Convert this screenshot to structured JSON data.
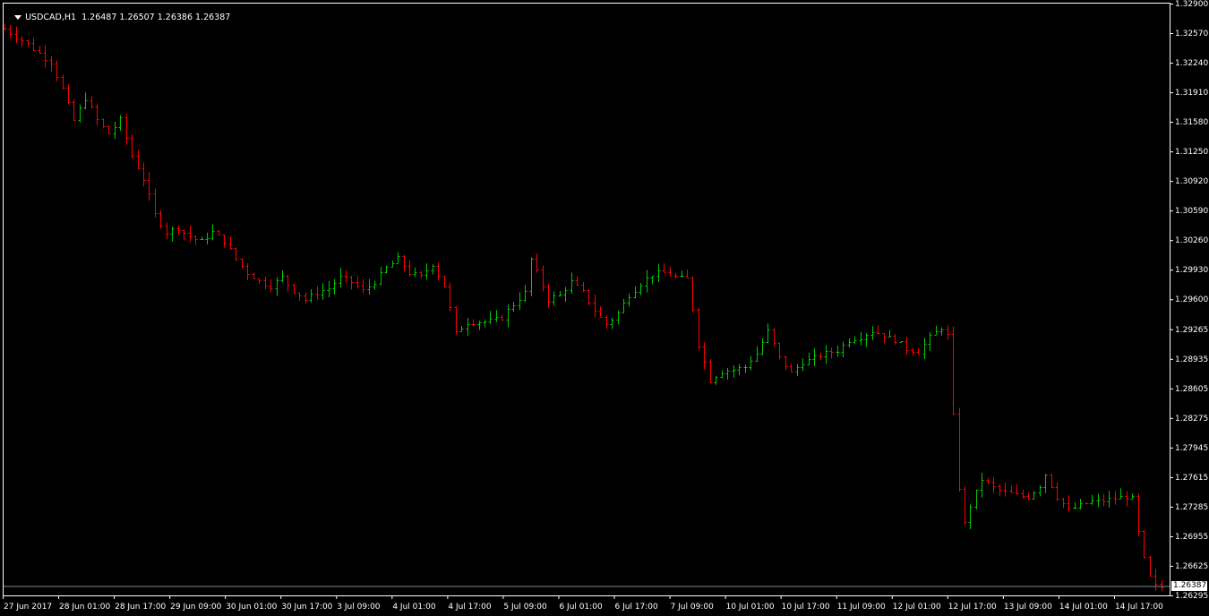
{
  "window": {
    "symbol": "USDCAD,H1",
    "ohlc": "1.26487 1.26507 1.26386 1.26387",
    "current_price_label": "1.26387"
  },
  "colors": {
    "background": "#000000",
    "foreground": "#ffffff",
    "bull": "#00c800",
    "bear": "#ff0000",
    "bid_line": "#778899"
  },
  "chart_data": {
    "type": "ohlc-bar",
    "symbol": "USDCAD",
    "timeframe": "H1",
    "ylim": [
      1.26295,
      1.329
    ],
    "y_ticks": [
      "1.32900",
      "1.32570",
      "1.32240",
      "1.31910",
      "1.31580",
      "1.31250",
      "1.30920",
      "1.30590",
      "1.30260",
      "1.29930",
      "1.29600",
      "1.29265",
      "1.28935",
      "1.28605",
      "1.28275",
      "1.27945",
      "1.27615",
      "1.27285",
      "1.26955",
      "1.26625",
      "1.26295"
    ],
    "x_ticks": [
      "27 Jun 2017",
      "28 Jun 01:00",
      "28 Jun 17:00",
      "29 Jun 09:00",
      "30 Jun 01:00",
      "30 Jun 17:00",
      "3 Jul 09:00",
      "4 Jul 01:00",
      "4 Jul 17:00",
      "5 Jul 09:00",
      "6 Jul 01:00",
      "6 Jul 17:00",
      "7 Jul 09:00",
      "10 Jul 01:00",
      "10 Jul 17:00",
      "11 Jul 09:00",
      "12 Jul 01:00",
      "12 Jul 17:00",
      "13 Jul 09:00",
      "14 Jul 01:00",
      "14 Jul 17:00"
    ],
    "last_close": 1.26387,
    "grid": false,
    "close_path": [
      [
        0,
        1.3262
      ],
      [
        4,
        1.3245
      ],
      [
        8,
        1.3225
      ],
      [
        10,
        1.3195
      ],
      [
        12,
        1.316
      ],
      [
        14,
        1.3185
      ],
      [
        16,
        1.316
      ],
      [
        18,
        1.3145
      ],
      [
        20,
        1.316
      ],
      [
        22,
        1.312
      ],
      [
        24,
        1.3095
      ],
      [
        26,
        1.3055
      ],
      [
        28,
        1.3035
      ],
      [
        30,
        1.304
      ],
      [
        32,
        1.303
      ],
      [
        34,
        1.3025
      ],
      [
        36,
        1.3035
      ],
      [
        38,
        1.3025
      ],
      [
        40,
        1.3005
      ],
      [
        42,
        1.299
      ],
      [
        44,
        1.298
      ],
      [
        46,
        1.2975
      ],
      [
        48,
        1.2985
      ],
      [
        50,
        1.297
      ],
      [
        52,
        1.296
      ],
      [
        54,
        1.2968
      ],
      [
        56,
        1.2972
      ],
      [
        58,
        1.2985
      ],
      [
        60,
        1.298
      ],
      [
        62,
        1.297
      ],
      [
        64,
        1.298
      ],
      [
        66,
        1.2995
      ],
      [
        68,
        1.3005
      ],
      [
        70,
        1.299
      ],
      [
        72,
        1.2985
      ],
      [
        74,
        1.3
      ],
      [
        76,
        1.2975
      ],
      [
        77,
        1.295
      ],
      [
        78,
        1.2922
      ],
      [
        80,
        1.2935
      ],
      [
        82,
        1.2935
      ],
      [
        84,
        1.2936
      ],
      [
        86,
        1.294
      ],
      [
        88,
        1.2955
      ],
      [
        90,
        1.2968
      ],
      [
        91,
        1.3005
      ],
      [
        92,
        1.299
      ],
      [
        94,
        1.296
      ],
      [
        96,
        1.2965
      ],
      [
        98,
        1.298
      ],
      [
        100,
        1.2968
      ],
      [
        102,
        1.2948
      ],
      [
        104,
        1.2932
      ],
      [
        106,
        1.2945
      ],
      [
        108,
        1.2965
      ],
      [
        110,
        1.2978
      ],
      [
        112,
        1.2988
      ],
      [
        114,
        1.299
      ],
      [
        116,
        1.2985
      ],
      [
        118,
        1.2983
      ],
      [
        119,
        1.295
      ],
      [
        120,
        1.291
      ],
      [
        122,
        1.287
      ],
      [
        124,
        1.288
      ],
      [
        126,
        1.2882
      ],
      [
        128,
        1.2885
      ],
      [
        130,
        1.29
      ],
      [
        132,
        1.2925
      ],
      [
        134,
        1.2895
      ],
      [
        136,
        1.2878
      ],
      [
        138,
        1.289
      ],
      [
        140,
        1.2895
      ],
      [
        142,
        1.29
      ],
      [
        144,
        1.2903
      ],
      [
        146,
        1.2915
      ],
      [
        148,
        1.2918
      ],
      [
        150,
        1.2925
      ],
      [
        152,
        1.292
      ],
      [
        154,
        1.2915
      ],
      [
        156,
        1.2905
      ],
      [
        158,
        1.2902
      ],
      [
        160,
        1.2918
      ],
      [
        162,
        1.2928
      ],
      [
        163,
        1.292
      ],
      [
        164,
        1.283
      ],
      [
        165,
        1.275
      ],
      [
        166,
        1.271
      ],
      [
        167,
        1.273
      ],
      [
        169,
        1.276
      ],
      [
        171,
        1.275
      ],
      [
        173,
        1.2745
      ],
      [
        175,
        1.2742
      ],
      [
        177,
        1.274
      ],
      [
        179,
        1.2752
      ],
      [
        180,
        1.2765
      ],
      [
        182,
        1.274
      ],
      [
        184,
        1.2725
      ],
      [
        186,
        1.273
      ],
      [
        188,
        1.2735
      ],
      [
        190,
        1.2735
      ],
      [
        192,
        1.2738
      ],
      [
        194,
        1.274
      ],
      [
        195,
        1.2738
      ],
      [
        196,
        1.27
      ],
      [
        197,
        1.267
      ],
      [
        198,
        1.265
      ],
      [
        199,
        1.264
      ],
      [
        200,
        1.26387
      ]
    ]
  }
}
